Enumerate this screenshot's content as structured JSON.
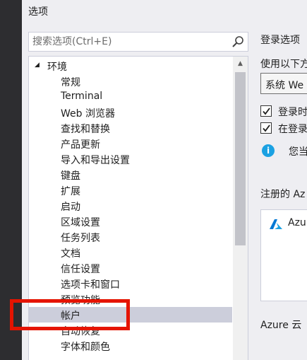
{
  "window": {
    "title": "选项"
  },
  "search": {
    "placeholder": "搜索选项(Ctrl+E)"
  },
  "tree": {
    "root_label": "环境",
    "items": [
      "常规",
      "Terminal",
      "Web 浏览器",
      "查找和替换",
      "产品更新",
      "导入和导出设置",
      "键盘",
      "扩展",
      "启动",
      "区域设置",
      "任务列表",
      "文档",
      "信任设置",
      "选项卡和窗口",
      "预览功能",
      "帐户",
      "自动恢复",
      "字体和颜色"
    ],
    "selected_index": 15
  },
  "right_panel": {
    "section_title": "登录选项",
    "use_label": "使用以下方",
    "combo_value": "系统 We",
    "checkbox1_label": "登录时",
    "checkbox2_label": "在登录",
    "info_text": "您当",
    "registered_label": "注册的 Az",
    "registered_item": "Azu",
    "azure_cloud_label": "Azure 云"
  },
  "colors": {
    "dialog_bg": "#eeeef2",
    "selected_bg": "#cccedb",
    "highlight_box": "#e51400",
    "info_blue": "#1ba1e2",
    "azure_blue": "#0078d4"
  }
}
